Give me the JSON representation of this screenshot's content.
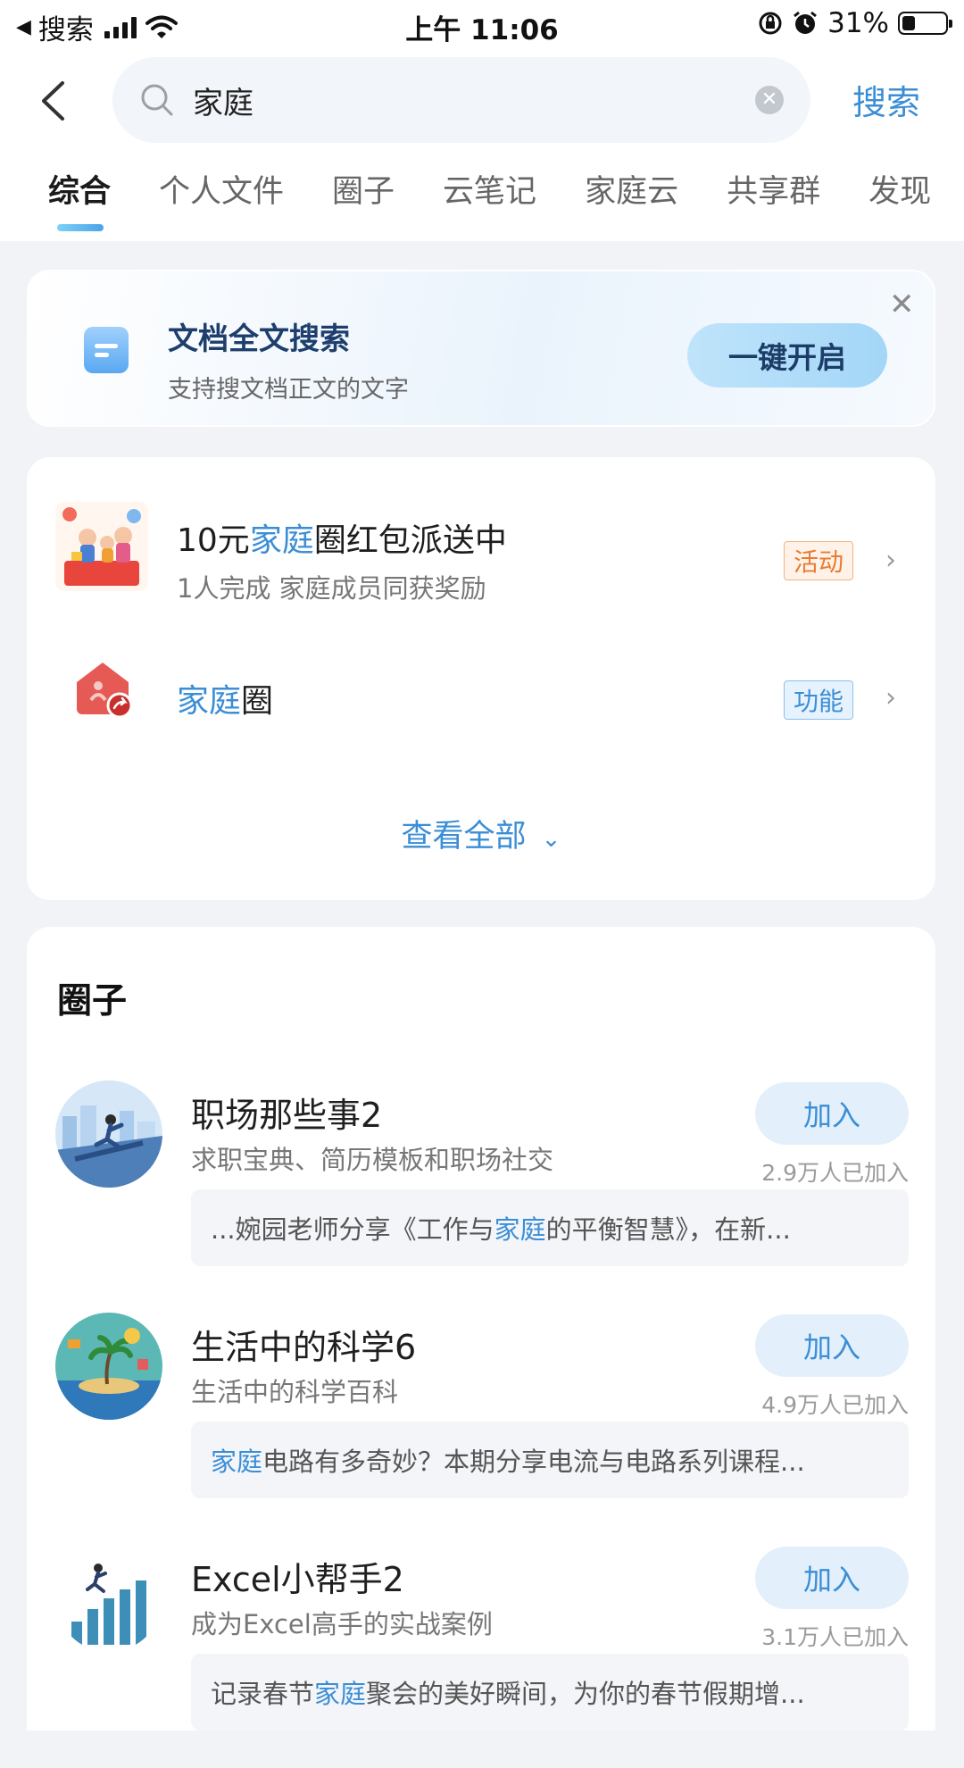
{
  "status_bar": {
    "back_app": "搜索",
    "time": "上午 11:06",
    "battery": "31%",
    "battery_level": 0.31
  },
  "search": {
    "query": "家庭",
    "button_label": "搜索"
  },
  "tabs": [
    {
      "label": "综合",
      "active": true
    },
    {
      "label": "个人文件",
      "active": false
    },
    {
      "label": "圈子",
      "active": false
    },
    {
      "label": "云笔记",
      "active": false
    },
    {
      "label": "家庭云",
      "active": false
    },
    {
      "label": "共享群",
      "active": false
    },
    {
      "label": "发现",
      "active": false
    }
  ],
  "doc_banner": {
    "title": "文档全文搜索",
    "subtitle": "支持搜文档正文的文字",
    "button_label": "一键开启"
  },
  "functions": {
    "items": [
      {
        "title_pre": "10元",
        "title_hl": "家庭",
        "title_post": "圈红包派送中",
        "subtitle": "1人完成  家庭成员同获奖励",
        "tag": "活动"
      },
      {
        "title_pre": "",
        "title_hl": "家庭",
        "title_post": "圈",
        "subtitle": "",
        "tag": "功能"
      }
    ],
    "view_all": "查看全部"
  },
  "circles": {
    "section_title": "圈子",
    "join_label": "加入",
    "items": [
      {
        "name": "职场那些事2",
        "desc": "求职宝典、简历模板和职场社交",
        "count": "2.9万人已加入",
        "snippet_pre": "...婉园老师分享《工作与",
        "snippet_hl": "家庭",
        "snippet_post": "的平衡智慧》，在新..."
      },
      {
        "name": "生活中的科学6",
        "desc": "生活中的科学百科",
        "count": "4.9万人已加入",
        "snippet_pre": "",
        "snippet_hl": "家庭",
        "snippet_post": "电路有多奇妙？本期分享电流与电路系列课程..."
      },
      {
        "name": "Excel小帮手2",
        "desc": "成为Excel高手的实战案例",
        "count": "3.1万人已加入",
        "snippet_pre": "记录春节",
        "snippet_hl": "家庭",
        "snippet_post": "聚会的美好瞬间，为你的春节假期增..."
      }
    ]
  },
  "colors": {
    "accent": "#3b8ed6",
    "activity_tag": "#ea7b32",
    "page_bg": "#f1f3f7"
  }
}
